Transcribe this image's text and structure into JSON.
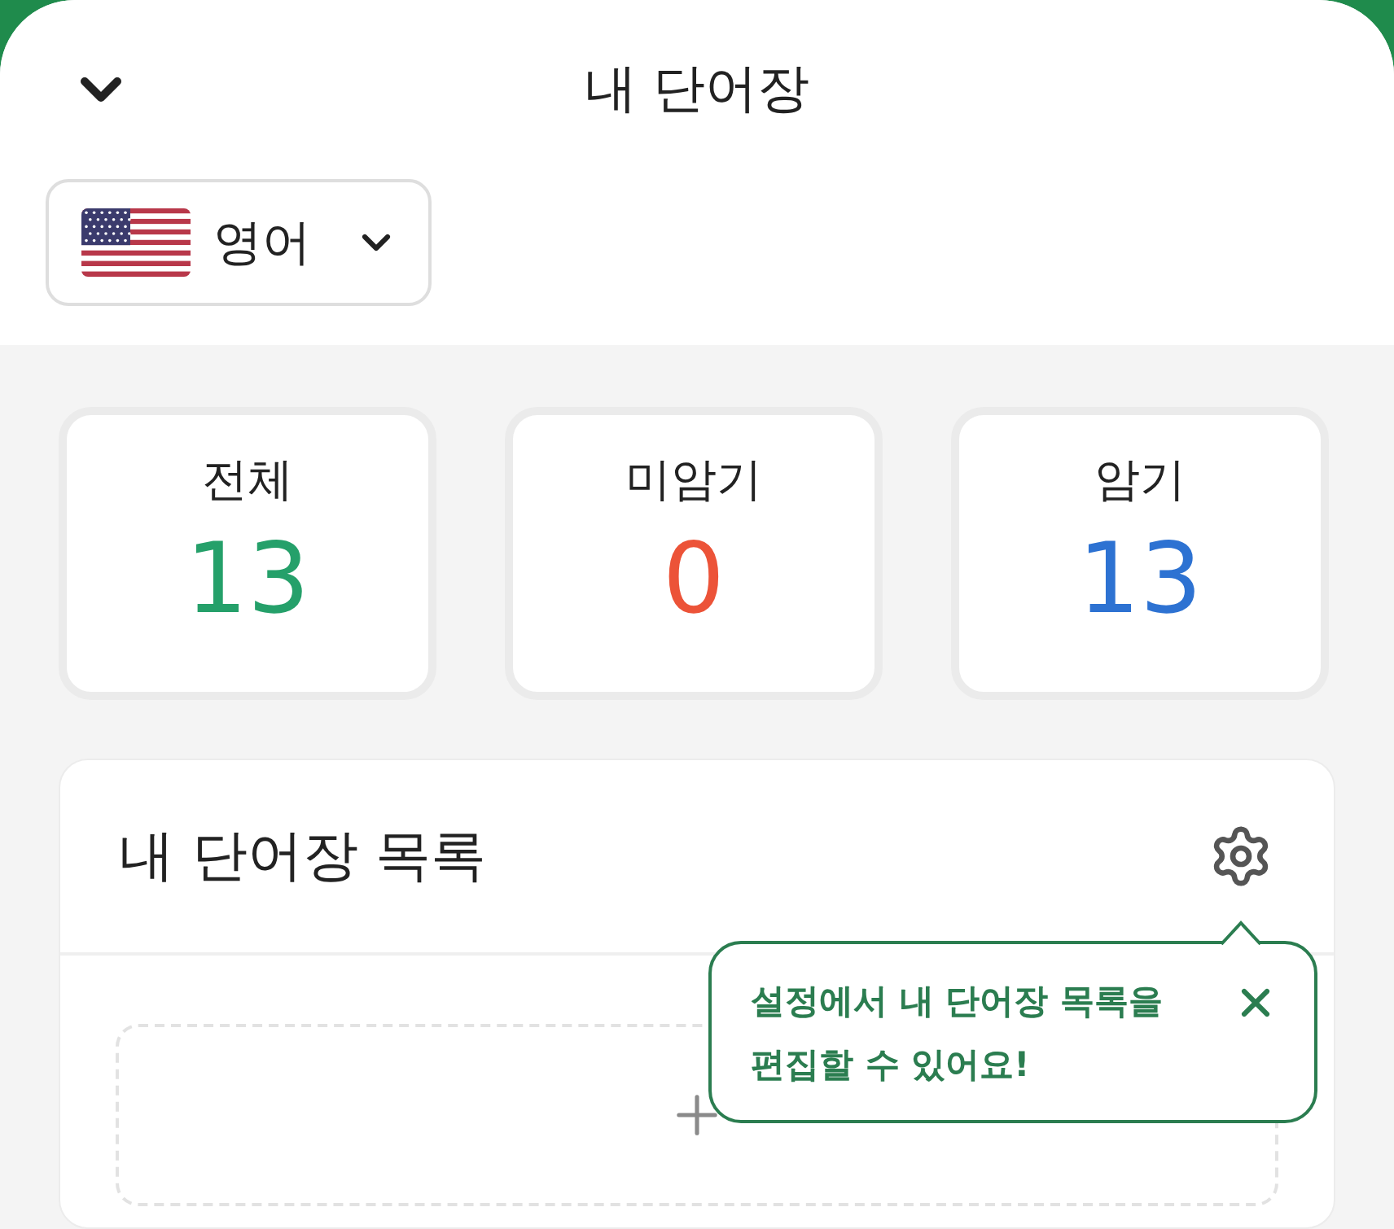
{
  "header": {
    "title": "내 단어장"
  },
  "language_select": {
    "value": "영어"
  },
  "stats": [
    {
      "label": "전체",
      "value": "13",
      "color": "#25a06a"
    },
    {
      "label": "미암기",
      "value": "0",
      "color": "#ec5338"
    },
    {
      "label": "암기",
      "value": "13",
      "color": "#2d72d2"
    }
  ],
  "list_panel": {
    "title": "내 단어장 목록"
  },
  "tooltip": {
    "lines": [
      "설정에서 내 단어장 목록을",
      "편집할 수 있어요!"
    ]
  }
}
